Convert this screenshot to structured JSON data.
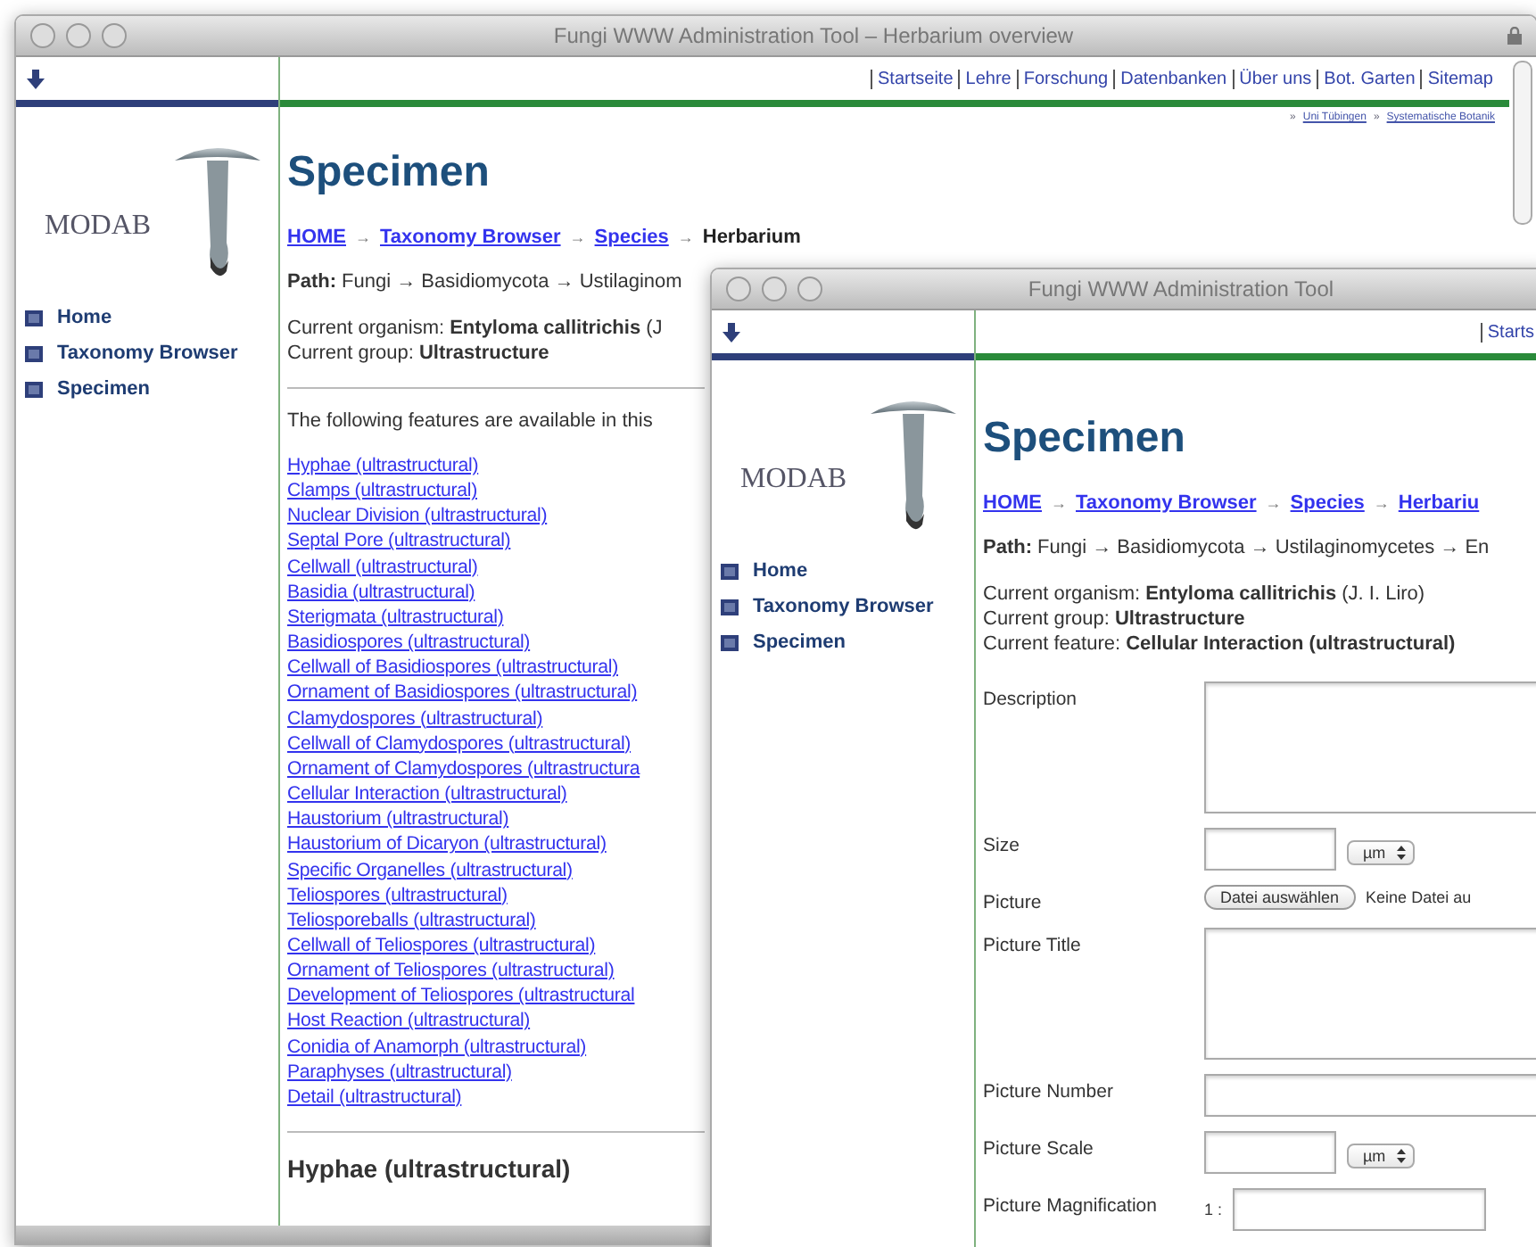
{
  "windows": [
    {
      "title": "Fungi WWW Administration Tool – Herbarium overview",
      "nav": [
        "Startseite",
        "Lehre",
        "Forschung",
        "Datenbanken",
        "Über uns",
        "Bot. Garten",
        "Sitemap"
      ],
      "subnav": [
        "Uni Tübingen",
        "Systematische Botanik"
      ],
      "subnav_marker": "»",
      "sidebar": {
        "logo_text": "MODAB",
        "items": [
          "Home",
          "Taxonomy Browser",
          "Specimen"
        ]
      },
      "page": {
        "heading": "Specimen",
        "breadcrumb": [
          {
            "label": "HOME",
            "kind": "link"
          },
          {
            "label": "Taxonomy Browser",
            "kind": "link"
          },
          {
            "label": "Species",
            "kind": "link"
          },
          {
            "label": "Herbarium",
            "kind": "current"
          }
        ],
        "separator": "→",
        "info": [
          {
            "kind": "para",
            "text": "**Path:** Fungi → Basidiomycota → Ustilaginom"
          },
          {
            "kind": "line",
            "text": "Current organism: **Entyloma callitrichis** (J"
          },
          {
            "kind": "line",
            "text": "Current group: **Ultrastructure**"
          }
        ],
        "intro": "The following features are available in this",
        "features": [
          "Hyphae (ultrastructural)",
          "Clamps (ultrastructural)",
          "Nuclear Division (ultrastructural)",
          "Septal Pore (ultrastructural)",
          "Cellwall (ultrastructural)",
          "Basidia (ultrastructural)",
          "Sterigmata (ultrastructural)",
          "Basidiospores (ultrastructural)",
          "Cellwall of Basidiospores (ultrastructural)",
          "Ornament of Basidiospores (ultrastructural)",
          "Clamydospores (ultrastructural)",
          "Cellwall of Clamydospores (ultrastructural)",
          "Ornament of Clamydospores (ultrastructura",
          "Cellular Interaction (ultrastructural)",
          "Haustorium (ultrastructural)",
          "Haustorium of Dicaryon (ultrastructural)",
          "Specific Organelles (ultrastructural)",
          "Teliospores (ultrastructural)",
          "Teliosporeballs (ultrastructural)",
          "Cellwall of Teliospores (ultrastructural)",
          "Ornament of Teliospores (ultrastructural)",
          "Development of Teliospores (ultrastructural",
          "Host Reaction (ultrastructural)",
          "Conidia of Anamorph (ultrastructural)",
          "Paraphyses (ultrastructural)",
          "Detail (ultrastructural)"
        ],
        "section_heading": "Hyphae (ultrastructural)"
      }
    },
    {
      "title": "Fungi WWW Administration Tool",
      "nav": [
        "Starts"
      ],
      "sidebar": {
        "logo_text": "MODAB",
        "items": [
          "Home",
          "Taxonomy Browser",
          "Specimen"
        ]
      },
      "page": {
        "heading": "Specimen",
        "breadcrumb": [
          {
            "label": "HOME",
            "kind": "link"
          },
          {
            "label": "Taxonomy Browser",
            "kind": "link"
          },
          {
            "label": "Species",
            "kind": "link"
          },
          {
            "label": "Herbariu",
            "kind": "link"
          }
        ],
        "separator": "→",
        "info": [
          {
            "kind": "para",
            "text": "**Path:** Fungi → Basidiomycota → Ustilaginomycetes → En"
          },
          {
            "kind": "line",
            "text": "Current organism: **Entyloma callitrichis** (J. I. Liro)"
          },
          {
            "kind": "line",
            "text": "Current group: **Ultrastructure**"
          },
          {
            "kind": "line",
            "text": "Current feature: **Cellular Interaction (ultrastructural)**"
          }
        ],
        "form": [
          {
            "label": "Description",
            "kind": "textarea"
          },
          {
            "label": "Size",
            "kind": "unit",
            "unit": "µm"
          },
          {
            "label": "Picture",
            "kind": "file",
            "button": "Datei auswählen",
            "status": "Keine Datei au"
          },
          {
            "label": "Picture Title",
            "kind": "textarea"
          },
          {
            "label": "Picture Number",
            "kind": "input"
          },
          {
            "label": "Picture Scale",
            "kind": "unit",
            "unit": "µm"
          },
          {
            "label": "Picture Magnification",
            "kind": "ratio",
            "prefix": "1 :"
          }
        ]
      }
    }
  ]
}
